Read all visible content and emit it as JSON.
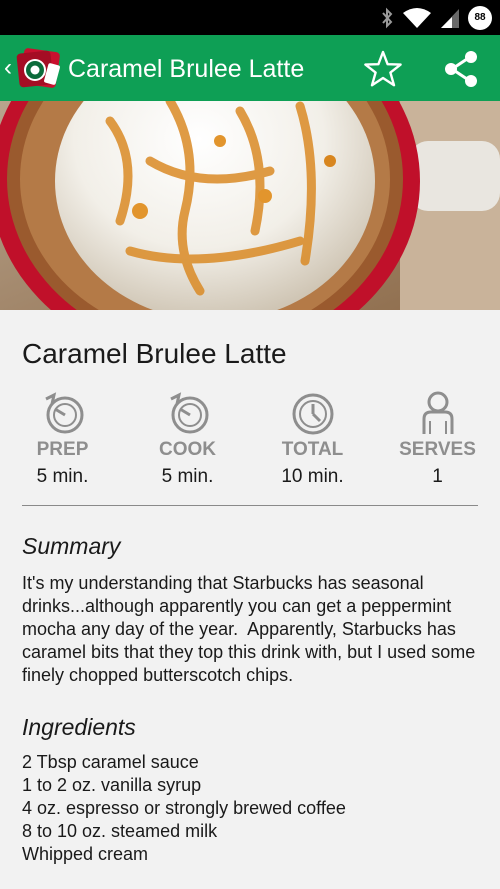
{
  "status_bar": {
    "icons": [
      "bluetooth-icon",
      "wifi-icon",
      "signal-icon",
      "battery-icon"
    ],
    "battery": "88"
  },
  "app_bar": {
    "title": "Caramel Brulee Latte",
    "background": "#0e9f55",
    "actions": [
      "star-icon",
      "share-icon"
    ]
  },
  "recipe": {
    "title": "Caramel Brulee Latte",
    "stats": [
      {
        "icon": "timer-icon",
        "label": "PREP",
        "value": "5 min."
      },
      {
        "icon": "timer-icon",
        "label": "COOK",
        "value": "5 min."
      },
      {
        "icon": "clock-icon",
        "label": "TOTAL",
        "value": "10 min."
      },
      {
        "icon": "person-icon",
        "label": "SERVES",
        "value": "1"
      }
    ],
    "summary_heading": "Summary",
    "summary": "It's my understanding that Starbucks has seasonal drinks...although apparently you can get a peppermint mocha any day of the year.  Apparently, Starbucks has caramel bits that they top this drink with, but I used some finely chopped butterscotch chips.",
    "ingredients_heading": "Ingredients",
    "ingredients": [
      "2 Tbsp caramel sauce",
      "1 to 2 oz. vanilla syrup",
      "4 oz. espresso or strongly brewed coffee",
      "8 to 10 oz. steamed milk",
      "Whipped cream"
    ]
  }
}
